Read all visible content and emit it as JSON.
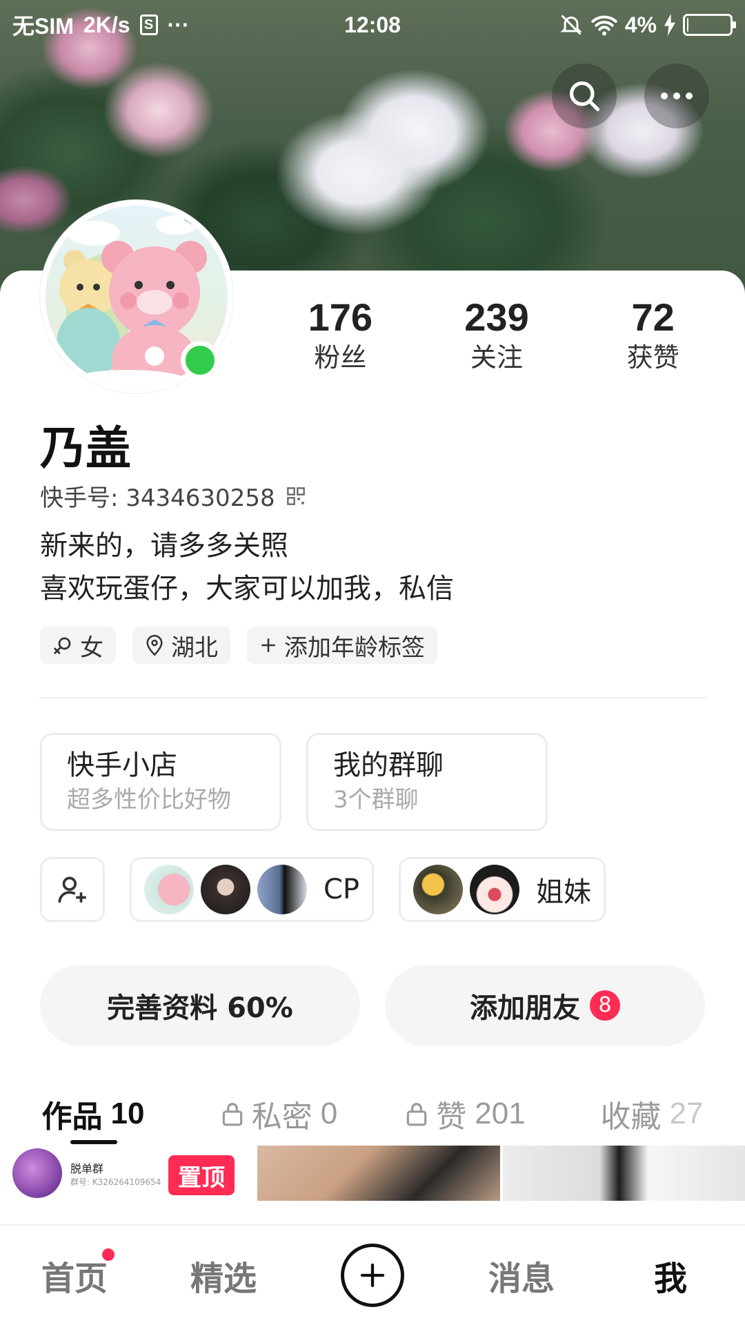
{
  "status_bar": {
    "carrier": "无SIM",
    "speed": "2K/s",
    "sim_icon_text": "S",
    "more": "···",
    "time": "12:08",
    "battery": "4%",
    "battery_level": 0.04
  },
  "profile": {
    "stats": [
      {
        "value": "176",
        "label": "粉丝"
      },
      {
        "value": "239",
        "label": "关注"
      },
      {
        "value": "72",
        "label": "获赞"
      }
    ],
    "name": "乃盖",
    "kwai_id": "快手号: 3434630258",
    "bio_line1": "新来的，请多多关照",
    "bio_line2": "喜欢玩蛋仔，大家可以加我，私信",
    "tags": {
      "gender": "女",
      "location": "湖北",
      "age": "添加年龄标签"
    }
  },
  "cards": [
    {
      "title": "快手小店",
      "sub": "超多性价比好物"
    },
    {
      "title": "我的群聊",
      "sub": "3个群聊"
    }
  ],
  "groups": [
    {
      "label": "CP"
    },
    {
      "label": "姐妹"
    }
  ],
  "actions": {
    "complete": "完善资料 60%",
    "add_friend": "添加朋友",
    "add_friend_badge": "8"
  },
  "tabs": [
    {
      "label": "作品",
      "count": "10"
    },
    {
      "label": "私密",
      "count": "0"
    },
    {
      "label": "赞",
      "count": "201"
    },
    {
      "label": "收藏",
      "count": "27"
    }
  ],
  "works": {
    "first": {
      "title": "脱单群",
      "sub": "群号: K326264109654",
      "pin": "置顶"
    }
  },
  "nav": {
    "home": "首页",
    "featured": "精选",
    "messages": "消息",
    "me": "我"
  },
  "colors": {
    "accent": "#fe2c55",
    "online": "#33cc4a"
  }
}
